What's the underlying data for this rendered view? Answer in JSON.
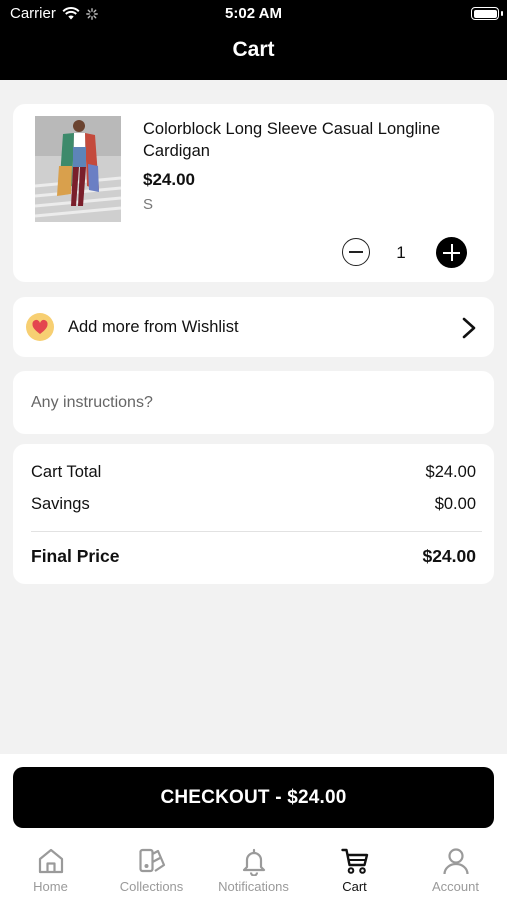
{
  "status_bar": {
    "carrier": "Carrier",
    "time": "5:02 AM"
  },
  "header": {
    "title": "Cart"
  },
  "cart_item": {
    "name": "Colorblock Long Sleeve Casual Longline Cardigan",
    "price": "$24.00",
    "size": "S",
    "quantity": "1"
  },
  "wishlist": {
    "label": "Add more from Wishlist"
  },
  "instructions": {
    "placeholder": "Any instructions?"
  },
  "totals": {
    "cart_total_label": "Cart Total",
    "cart_total_value": "$24.00",
    "savings_label": "Savings",
    "savings_value": "$0.00",
    "final_price_label": "Final Price",
    "final_price_value": "$24.00"
  },
  "checkout": {
    "label": "CHECKOUT - $24.00"
  },
  "tabbar": {
    "items": [
      {
        "label": "Home",
        "icon": "home-icon"
      },
      {
        "label": "Collections",
        "icon": "collections-icon"
      },
      {
        "label": "Notifications",
        "icon": "bell-icon"
      },
      {
        "label": "Cart",
        "icon": "cart-icon",
        "active": true
      },
      {
        "label": "Account",
        "icon": "account-icon"
      }
    ]
  },
  "colors": {
    "header_bg": "#000000",
    "accent": "#000000",
    "wishlist_icon_bg": "#f7cf72",
    "heart": "#e4454f"
  }
}
